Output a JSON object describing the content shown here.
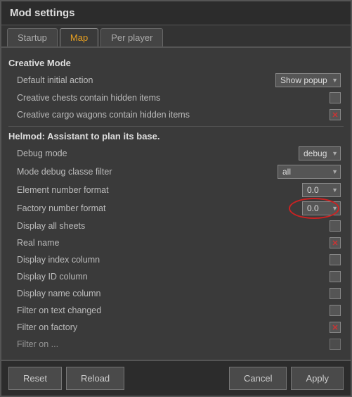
{
  "title": "Mod settings",
  "tabs": [
    {
      "label": "Startup",
      "active": false
    },
    {
      "label": "Map",
      "active": true
    },
    {
      "label": "Per player",
      "active": false
    }
  ],
  "sections": {
    "creative_mode": {
      "header": "Creative Mode",
      "rows": [
        {
          "label": "Default initial action",
          "control": "dropdown",
          "value": "Show popup",
          "size": "normal"
        },
        {
          "label": "Creative chests contain hidden items",
          "control": "checkbox",
          "checked": false,
          "type": "plain"
        },
        {
          "label": "Creative cargo wagons contain hidden items",
          "control": "checkbox",
          "checked": true,
          "type": "x"
        }
      ]
    },
    "helmod": {
      "header": "Helmod: Assistant to plan its base.",
      "rows": [
        {
          "label": "Debug mode",
          "control": "dropdown",
          "value": "debug",
          "size": "small"
        },
        {
          "label": "Mode debug classe filter",
          "control": "dropdown",
          "value": "all",
          "size": "normal"
        },
        {
          "label": "Element number format",
          "control": "dropdown",
          "value": "0.0",
          "size": "small"
        },
        {
          "label": "Factory number format",
          "control": "dropdown",
          "value": "0.0",
          "size": "small",
          "highlighted": true
        },
        {
          "label": "Display all sheets",
          "control": "checkbox",
          "checked": false,
          "type": "plain"
        },
        {
          "label": "Real name",
          "control": "checkbox",
          "checked": true,
          "type": "x"
        },
        {
          "label": "Display index column",
          "control": "checkbox",
          "checked": false,
          "type": "plain"
        },
        {
          "label": "Display ID column",
          "control": "checkbox",
          "checked": false,
          "type": "plain"
        },
        {
          "label": "Display name column",
          "control": "checkbox",
          "checked": false,
          "type": "plain"
        },
        {
          "label": "Filter on text changed",
          "control": "checkbox",
          "checked": false,
          "type": "plain"
        },
        {
          "label": "Filter on factory",
          "control": "checkbox",
          "checked": true,
          "type": "x"
        },
        {
          "label": "Filter on ...",
          "control": "checkbox",
          "checked": false,
          "type": "plain"
        }
      ]
    }
  },
  "footer": {
    "reset_label": "Reset",
    "reload_label": "Reload",
    "cancel_label": "Cancel",
    "apply_label": "Apply"
  }
}
